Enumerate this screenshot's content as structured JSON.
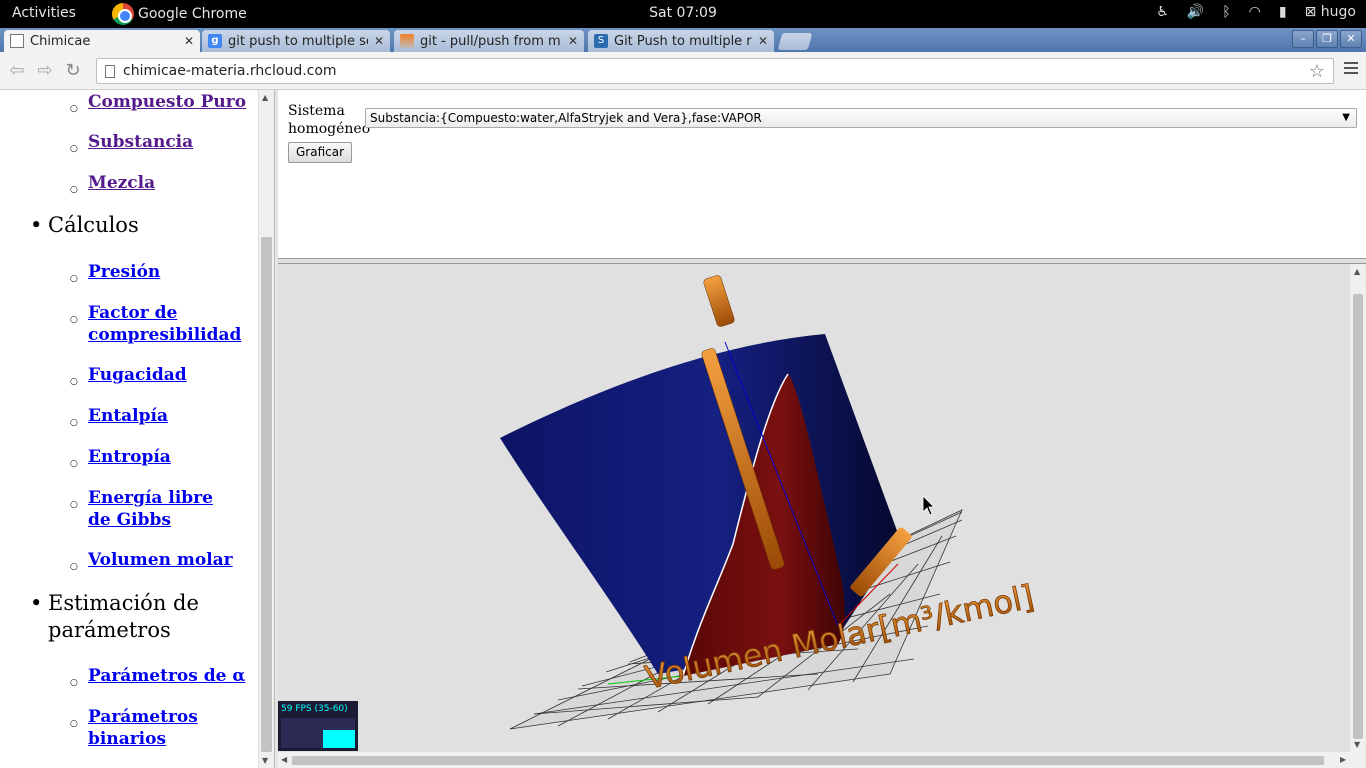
{
  "topbar": {
    "activities": "Activities",
    "app_name": "Google Chrome",
    "clock": "Sat 07:09",
    "user": "hugo",
    "tray_icons": [
      "accessibility-icon",
      "volume-icon",
      "bluetooth-icon",
      "wifi-icon",
      "battery-icon",
      "user-icon"
    ]
  },
  "tabs": [
    {
      "title": "Chimicae",
      "active": true,
      "favicon": "page-icon"
    },
    {
      "title": "git push to multiple se",
      "active": false,
      "favicon": "google-icon"
    },
    {
      "title": "git - pull/push from m",
      "active": false,
      "favicon": "stackoverflow-icon"
    },
    {
      "title": "Git Push to multiple re",
      "active": false,
      "favicon": "superuser-icon"
    }
  ],
  "omnibox": {
    "url": "chimicae-materia.rhcloud.com"
  },
  "sidebar": {
    "items_top": [
      {
        "label": "Compuesto Puro",
        "visited": true
      },
      {
        "label": "Substancia",
        "visited": true
      },
      {
        "label": "Mezcla",
        "visited": true
      }
    ],
    "sections": [
      {
        "label": "Cálculos",
        "items": [
          {
            "label": "Presión"
          },
          {
            "label": "Factor de compresibilidad"
          },
          {
            "label": "Fugacidad"
          },
          {
            "label": "Entalpía"
          },
          {
            "label": "Entropía"
          },
          {
            "label": "Energía libre de Gibbs"
          },
          {
            "label": "Volumen molar"
          }
        ]
      },
      {
        "label": "Estimación de parámetros",
        "items": [
          {
            "label": "Parámetros de α"
          },
          {
            "label": "Parámetros binarios"
          }
        ]
      }
    ]
  },
  "form": {
    "system_label": "Sistema homogéneo",
    "selected_value": "Substancia:{Compuesto:water,AlfaStryjek and Vera},fase:VAPOR",
    "graph_button": "Graficar"
  },
  "plot": {
    "x_axis_label": "Volumen Molar[m³/kmol]",
    "fps_text": "59 FPS (35-60)",
    "colors": {
      "surface_blue": "#101866",
      "surface_red": "#6a0808",
      "label_orange": "#e07a10",
      "background": "#e0e0e0"
    }
  }
}
